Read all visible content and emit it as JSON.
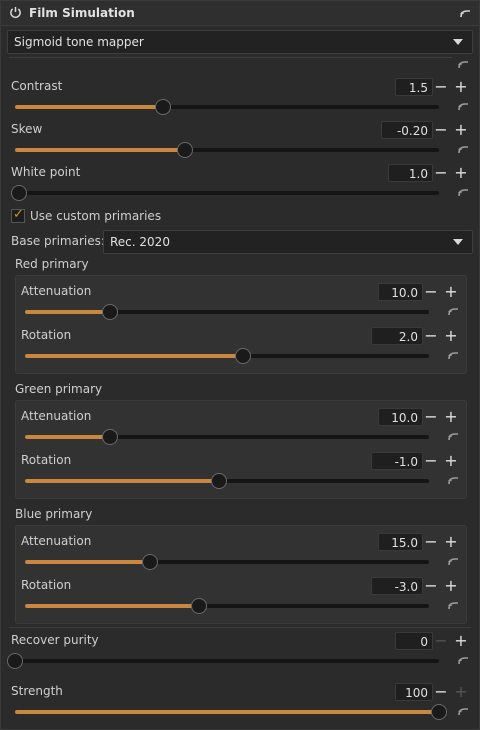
{
  "module": {
    "title": "Film Simulation",
    "tone_mapper": "Sigmoid tone mapper"
  },
  "sliders": {
    "contrast": {
      "label": "Contrast",
      "value": "1.5",
      "fraction": 0.35
    },
    "skew": {
      "label": "Skew",
      "value": "-0.20",
      "fraction": 0.4
    },
    "white_point": {
      "label": "White point",
      "value": "1.0",
      "fraction": 0.01
    },
    "red_attenuation": {
      "label": "Attenuation",
      "value": "10.0",
      "fraction": 0.21
    },
    "red_rotation": {
      "label": "Rotation",
      "value": "2.0",
      "fraction": 0.54
    },
    "green_attenuation": {
      "label": "Attenuation",
      "value": "10.0",
      "fraction": 0.21
    },
    "green_rotation": {
      "label": "Rotation",
      "value": "-1.0",
      "fraction": 0.48
    },
    "blue_attenuation": {
      "label": "Attenuation",
      "value": "15.0",
      "fraction": 0.31
    },
    "blue_rotation": {
      "label": "Rotation",
      "value": "-3.0",
      "fraction": 0.43
    },
    "recover_purity": {
      "label": "Recover purity",
      "value": "0",
      "fraction": 0.0
    },
    "strength": {
      "label": "Strength",
      "value": "100",
      "fraction": 1.0
    }
  },
  "custom_primaries": {
    "label": "Use custom primaries",
    "checked": true
  },
  "base_primaries": {
    "label": "Base primaries:",
    "value": "Rec. 2020"
  },
  "sections": {
    "red": "Red primary",
    "green": "Green primary",
    "blue": "Blue primary"
  },
  "colors": {
    "accent": "#c9873f",
    "background": "#2b2b2b"
  },
  "icons": {
    "power": "power-icon",
    "reset": "reset-icon",
    "dropdown": "chevron-down-icon",
    "minus": "minus-icon",
    "plus": "plus-icon",
    "check": "checkmark-icon"
  }
}
